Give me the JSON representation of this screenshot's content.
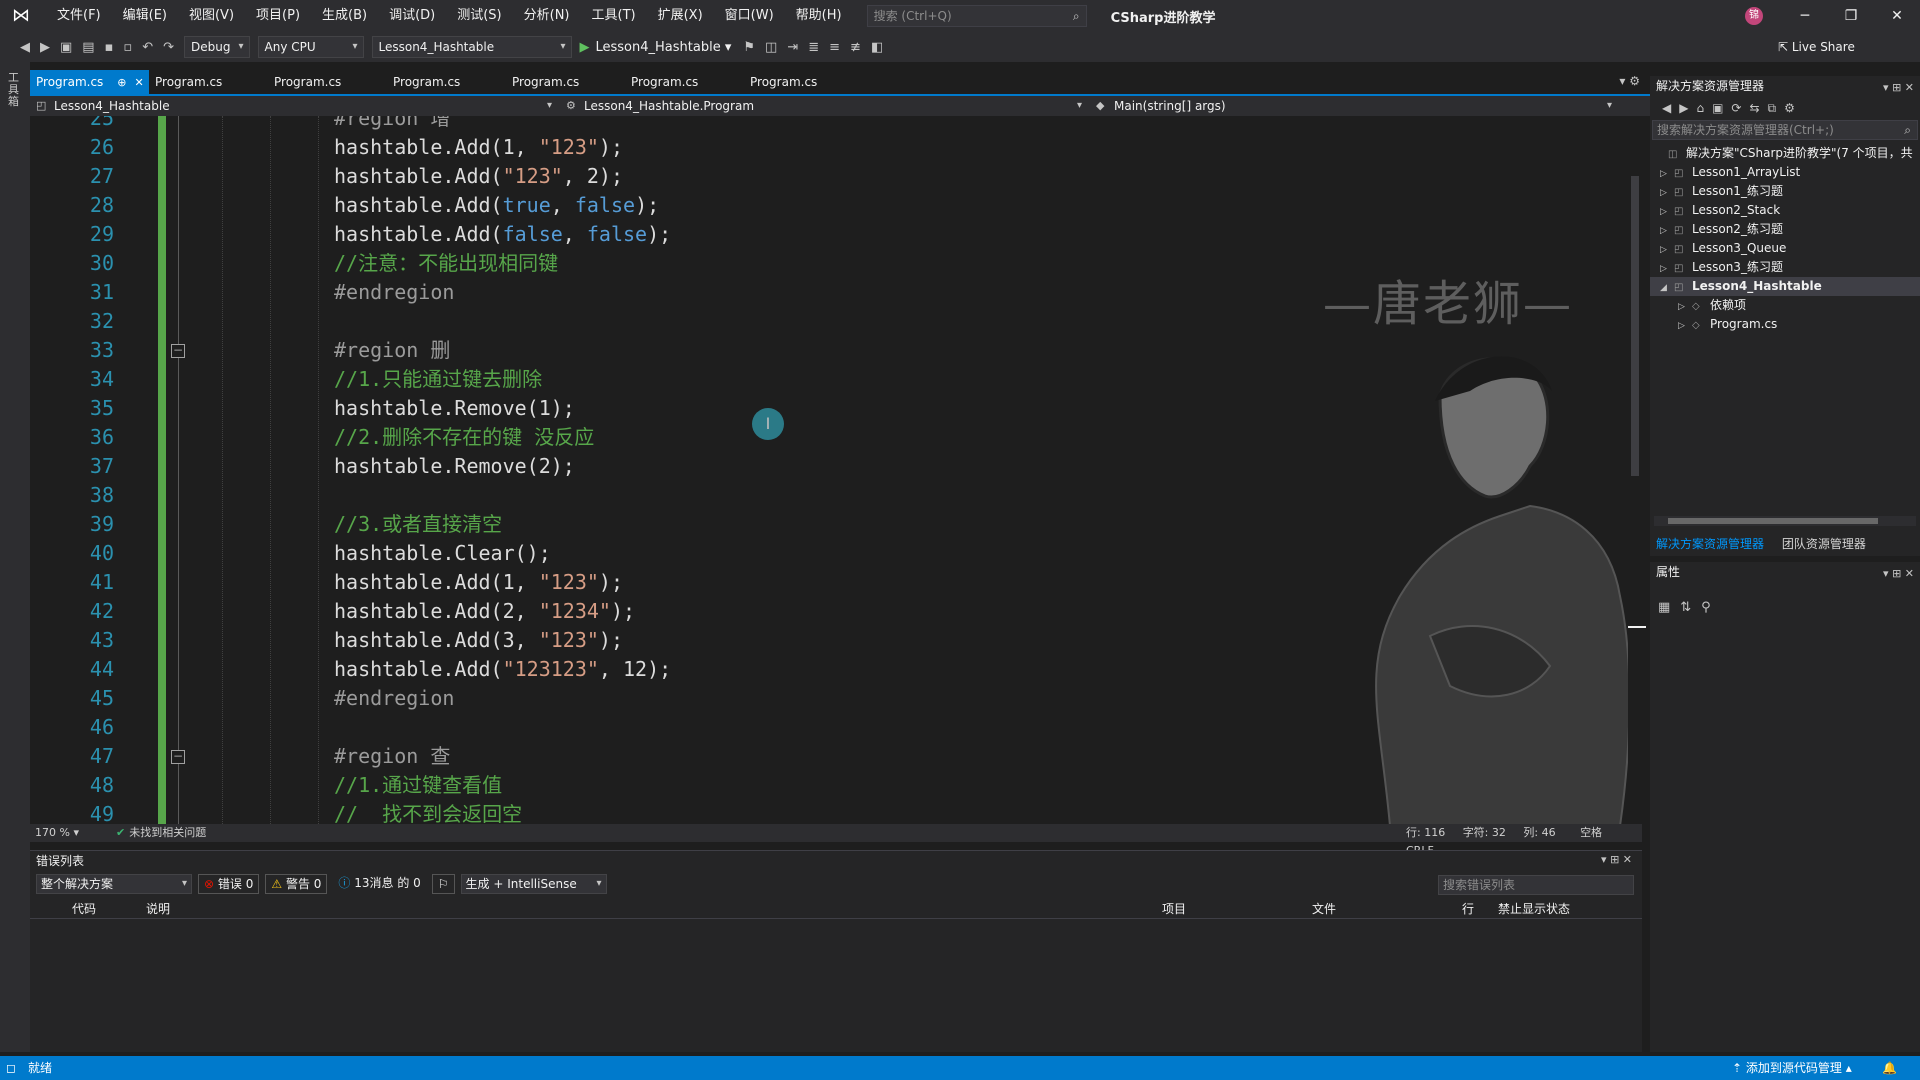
{
  "menu": {
    "items": [
      "文件(F)",
      "编辑(E)",
      "视图(V)",
      "项目(P)",
      "生成(B)",
      "调试(D)",
      "测试(S)",
      "分析(N)",
      "工具(T)",
      "扩展(X)",
      "窗口(W)",
      "帮助(H)"
    ],
    "search_placeholder": "搜索 (Ctrl+Q)",
    "solution_name": "CSharp进阶教学",
    "avatar_initials": "锦"
  },
  "window_controls": {
    "minimize": "─",
    "restore": "❐",
    "close": "✕"
  },
  "toolbar": {
    "config": "Debug",
    "platform": "Any CPU",
    "startup_project": "Lesson4_Hashtable",
    "run_label": "Lesson4_Hashtable",
    "live_share": "Live Share"
  },
  "left_strip": {
    "label": "工具箱"
  },
  "tabs": [
    {
      "label": "Program.cs",
      "active": true
    },
    {
      "label": "Program.cs"
    },
    {
      "label": "Program.cs"
    },
    {
      "label": "Program.cs"
    },
    {
      "label": "Program.cs"
    },
    {
      "label": "Program.cs"
    },
    {
      "label": "Program.cs"
    }
  ],
  "navbar": {
    "project": "Lesson4_Hashtable",
    "type": "Lesson4_Hashtable.Program",
    "member": "Main(string[] args)"
  },
  "editor": {
    "watermark_title": "—唐老狮—",
    "lines": [
      {
        "n": "25",
        "tokens": [
          {
            "t": "#region 增",
            "c": "rg"
          }
        ]
      },
      {
        "n": "26",
        "tokens": [
          {
            "t": "hashtable.Add(1, ",
            "c": ""
          },
          {
            "t": "\"123\"",
            "c": "str"
          },
          {
            "t": ");",
            "c": ""
          }
        ]
      },
      {
        "n": "27",
        "tokens": [
          {
            "t": "hashtable.Add(",
            "c": ""
          },
          {
            "t": "\"123\"",
            "c": "str"
          },
          {
            "t": ", 2);",
            "c": ""
          }
        ]
      },
      {
        "n": "28",
        "tokens": [
          {
            "t": "hashtable.Add(",
            "c": ""
          },
          {
            "t": "true",
            "c": "kw"
          },
          {
            "t": ", ",
            "c": ""
          },
          {
            "t": "false",
            "c": "kw"
          },
          {
            "t": ");",
            "c": ""
          }
        ]
      },
      {
        "n": "29",
        "tokens": [
          {
            "t": "hashtable.Add(",
            "c": ""
          },
          {
            "t": "false",
            "c": "kw"
          },
          {
            "t": ", ",
            "c": ""
          },
          {
            "t": "false",
            "c": "kw"
          },
          {
            "t": ");",
            "c": ""
          }
        ]
      },
      {
        "n": "30",
        "tokens": [
          {
            "t": "//注意：不能出现相同键",
            "c": "cm"
          }
        ]
      },
      {
        "n": "31",
        "tokens": [
          {
            "t": "#endregion",
            "c": "rg"
          }
        ]
      },
      {
        "n": "32",
        "tokens": []
      },
      {
        "n": "33",
        "tokens": [
          {
            "t": "#region 删",
            "c": "rg"
          }
        ],
        "fold": true
      },
      {
        "n": "34",
        "tokens": [
          {
            "t": "//1.只能通过键去删除",
            "c": "cm"
          }
        ]
      },
      {
        "n": "35",
        "tokens": [
          {
            "t": "hashtable.Remove(1);",
            "c": ""
          }
        ]
      },
      {
        "n": "36",
        "tokens": [
          {
            "t": "//2.删除不存在的键 没反应",
            "c": "cm"
          }
        ]
      },
      {
        "n": "37",
        "tokens": [
          {
            "t": "hashtable.Remove(2);",
            "c": ""
          }
        ]
      },
      {
        "n": "38",
        "tokens": []
      },
      {
        "n": "39",
        "tokens": [
          {
            "t": "//3.或者直接清空",
            "c": "cm"
          }
        ]
      },
      {
        "n": "40",
        "tokens": [
          {
            "t": "hashtable.Clear();",
            "c": ""
          }
        ]
      },
      {
        "n": "41",
        "tokens": [
          {
            "t": "hashtable.Add(1, ",
            "c": ""
          },
          {
            "t": "\"123\"",
            "c": "str"
          },
          {
            "t": ");",
            "c": ""
          }
        ]
      },
      {
        "n": "42",
        "tokens": [
          {
            "t": "hashtable.Add(2, ",
            "c": ""
          },
          {
            "t": "\"1234\"",
            "c": "str"
          },
          {
            "t": ");",
            "c": ""
          }
        ]
      },
      {
        "n": "43",
        "tokens": [
          {
            "t": "hashtable.Add(3, ",
            "c": ""
          },
          {
            "t": "\"123\"",
            "c": "str"
          },
          {
            "t": ");",
            "c": ""
          }
        ]
      },
      {
        "n": "44",
        "tokens": [
          {
            "t": "hashtable.Add(",
            "c": ""
          },
          {
            "t": "\"123123\"",
            "c": "str"
          },
          {
            "t": ", 12);",
            "c": ""
          }
        ]
      },
      {
        "n": "45",
        "tokens": [
          {
            "t": "#endregion",
            "c": "rg"
          }
        ]
      },
      {
        "n": "46",
        "tokens": []
      },
      {
        "n": "47",
        "tokens": [
          {
            "t": "#region 查",
            "c": "rg"
          }
        ],
        "fold": true
      },
      {
        "n": "48",
        "tokens": [
          {
            "t": "//1.通过键查看值",
            "c": "cm"
          }
        ]
      },
      {
        "n": "49",
        "tokens": [
          {
            "t": "//  找不到会返回空",
            "c": "cm"
          }
        ]
      }
    ]
  },
  "editor_status": {
    "zoom": "170 %",
    "issues": "未找到相关问题",
    "line": "行: 116",
    "char": "字符: 32",
    "col": "列: 46",
    "indent": "空格",
    "eol": "CRLF"
  },
  "error_list": {
    "title": "错误列表",
    "scope": "整个解决方案",
    "errors": "错误 0",
    "warnings": "警告 0",
    "messages": "13消息 的 0",
    "build_filter": "生成 + IntelliSense",
    "search_placeholder": "搜索错误列表",
    "columns": [
      "代码",
      "说明",
      "项目",
      "文件",
      "行",
      "禁止显示状态"
    ]
  },
  "solution_explorer": {
    "title": "解决方案资源管理器",
    "search_placeholder": "搜索解决方案资源管理器(Ctrl+;)",
    "root": "解决方案\"CSharp进阶教学\"(7 个项目，共",
    "items": [
      {
        "label": "Lesson1_ArrayList",
        "level": 1,
        "expanded": false
      },
      {
        "label": "Lesson1_练习题",
        "level": 1,
        "expanded": false
      },
      {
        "label": "Lesson2_Stack",
        "level": 1,
        "expanded": false
      },
      {
        "label": "Lesson2_练习题",
        "level": 1,
        "expanded": false
      },
      {
        "label": "Lesson3_Queue",
        "level": 1,
        "expanded": false
      },
      {
        "label": "Lesson3_练习题",
        "level": 1,
        "expanded": false
      },
      {
        "label": "Lesson4_Hashtable",
        "level": 1,
        "expanded": true,
        "selected": true
      },
      {
        "label": "依赖项",
        "level": 2,
        "expanded": false
      },
      {
        "label": "Program.cs",
        "level": 2,
        "expanded": false
      }
    ],
    "bottom_tabs": [
      "解决方案资源管理器",
      "团队资源管理器"
    ]
  },
  "properties": {
    "title": "属性"
  },
  "statusbar": {
    "ready": "就绪",
    "source_control": "添加到源代码管理",
    "accent": "#007acc"
  },
  "colors": {
    "accent": "#007acc",
    "keyword": "#569cd6",
    "string": "#d69d85",
    "comment": "#57a64a",
    "line_number": "#2b91af"
  }
}
